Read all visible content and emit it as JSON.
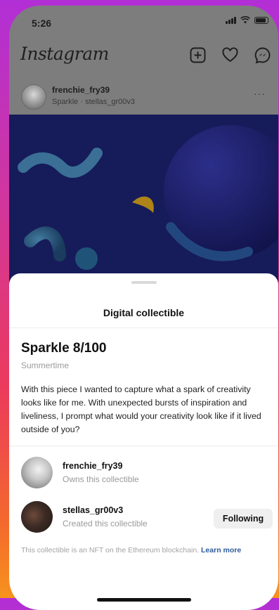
{
  "status_bar": {
    "time": "5:26"
  },
  "app": {
    "logo": "Instagram"
  },
  "top_icons": [
    "new-post-icon",
    "heart-icon",
    "messenger-icon"
  ],
  "post": {
    "username": "frenchie_fry39",
    "subtitle": "Sparkle · stellas_gr00v3",
    "more": "···"
  },
  "sheet": {
    "title": "Digital collectible",
    "nft_name": "Sparkle 8/100",
    "collection": "Summertime",
    "description": "With this piece I wanted to capture what a spark of creativity looks like for me. With unexpected bursts of inspiration and liveliness, I prompt what would your creativity look like if it lived outside of you?",
    "owner": {
      "name": "frenchie_fry39",
      "role": "Owns this collectible"
    },
    "creator": {
      "name": "stellas_gr00v3",
      "role": "Created this collectible",
      "button": "Following"
    },
    "footnote": "This collectible is an NFT on the Ethereum blockchain.",
    "learn_more": "Learn more"
  },
  "colors": {
    "accent_link": "#2e5b9a",
    "artwork_bg": "#1e2578",
    "overlay": "#7d7d7d"
  }
}
